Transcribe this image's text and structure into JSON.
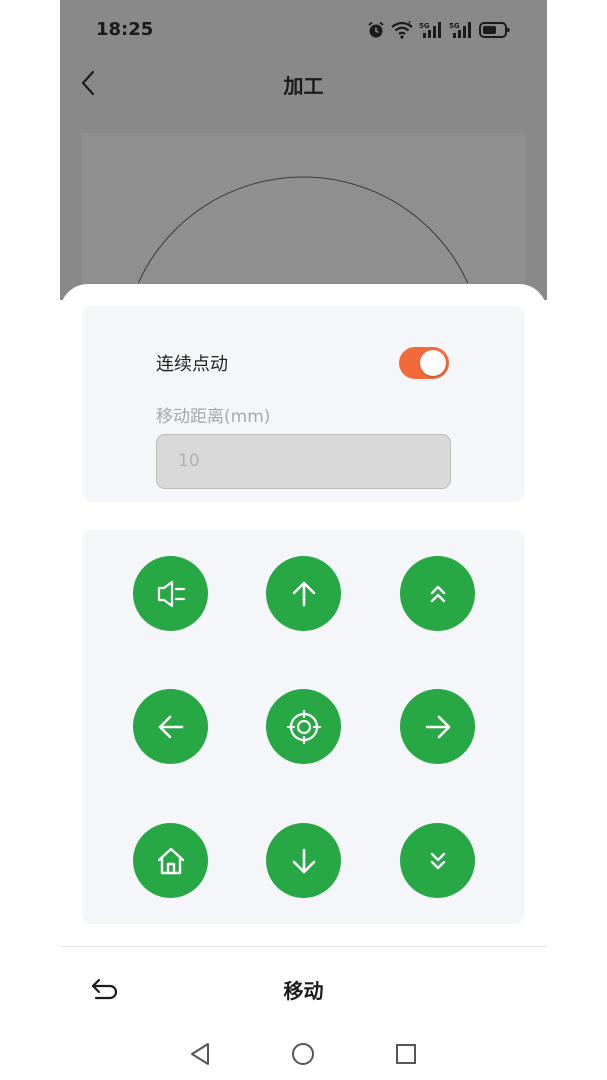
{
  "status_bar": {
    "time": "18:25",
    "icons": [
      "alarm-icon",
      "wifi-icon",
      "signal-5g-icon",
      "signal-5g-icon",
      "battery-icon"
    ],
    "signal_labels": [
      "5G",
      "5G"
    ],
    "wifi_label": "7"
  },
  "header": {
    "title": "加工",
    "back_icon": "chevron-left-icon"
  },
  "settings": {
    "continuous_jog_label": "连续点动",
    "continuous_jog_on": true,
    "distance_label": "移动距离(mm)",
    "distance_value": "10"
  },
  "jog_pad": {
    "buttons": [
      [
        "laser-icon",
        "arrow-up-icon",
        "double-chevron-up-icon"
      ],
      [
        "arrow-left-icon",
        "crosshair-target-icon",
        "arrow-right-icon"
      ],
      [
        "home-icon",
        "arrow-down-icon",
        "double-chevron-down-icon"
      ]
    ]
  },
  "footer": {
    "title": "移动",
    "back_icon": "return-arrow-icon"
  },
  "system_nav": [
    "back-triangle-icon",
    "home-circle-icon",
    "recents-square-icon"
  ],
  "colors": {
    "accent_green": "#28a745",
    "toggle_orange": "#f26a3b",
    "overlay_gray": "#898989",
    "card_bg": "#f4f6f9"
  }
}
